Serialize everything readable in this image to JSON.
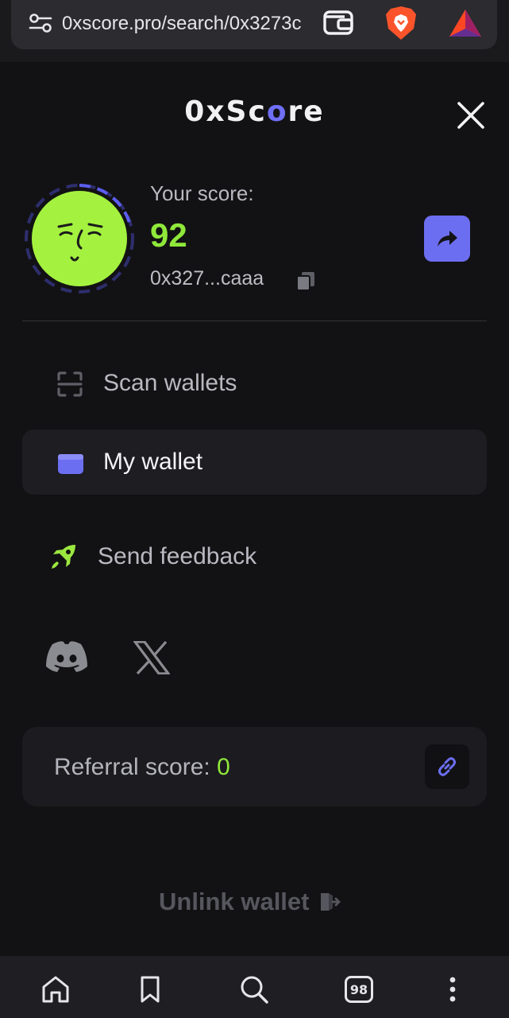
{
  "browser": {
    "url": "0xscore.pro/search/0x3273c",
    "tabs_count": "98",
    "icons": [
      "tune-icon",
      "wallet-icon",
      "brave-icon",
      "bat-icon"
    ]
  },
  "header": {
    "brand_prefix": "0xSc",
    "brand_o": "o",
    "brand_suffix": "re"
  },
  "profile": {
    "score_label": "Your score:",
    "score": "92",
    "address": "0x327...caaa"
  },
  "menu": {
    "items": [
      {
        "label": "Scan wallets",
        "icon": "scan-icon"
      },
      {
        "label": "My wallet",
        "icon": "wallet-icon"
      },
      {
        "label": "Send feedback",
        "icon": "rocket-icon"
      }
    ]
  },
  "referral": {
    "label": "Referral score: ",
    "value": "0"
  },
  "footer": {
    "unlink_label": "Unlink wallet"
  },
  "colors": {
    "background": "#121214",
    "accent": "#6c6ef2",
    "score_green": "#8fe83a"
  }
}
